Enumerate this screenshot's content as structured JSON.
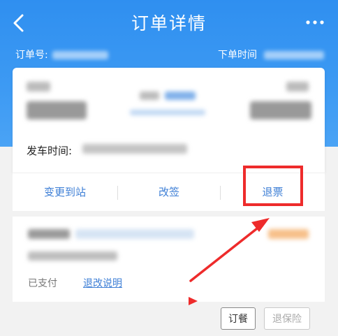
{
  "header": {
    "title": "订单详情",
    "order_no_label": "订单号:",
    "order_time_label": "下单时间"
  },
  "icons": {
    "back": "chevron-left-icon",
    "more": "more-dots-icon"
  },
  "ticket": {
    "depart_time_label": "发车时间:"
  },
  "actions": {
    "change_station": "变更到站",
    "reschedule": "改签",
    "refund": "退票"
  },
  "payment": {
    "status": "已支付",
    "refund_rules": "退改说明"
  },
  "footer": {
    "order_meal": "订餐",
    "cancel_insurance": "退保险"
  },
  "colors": {
    "header_blue": "#3d9af3",
    "link_blue": "#3e7fd6",
    "annotation_red": "#ee2b2b",
    "price_orange": "#f7a24a"
  }
}
